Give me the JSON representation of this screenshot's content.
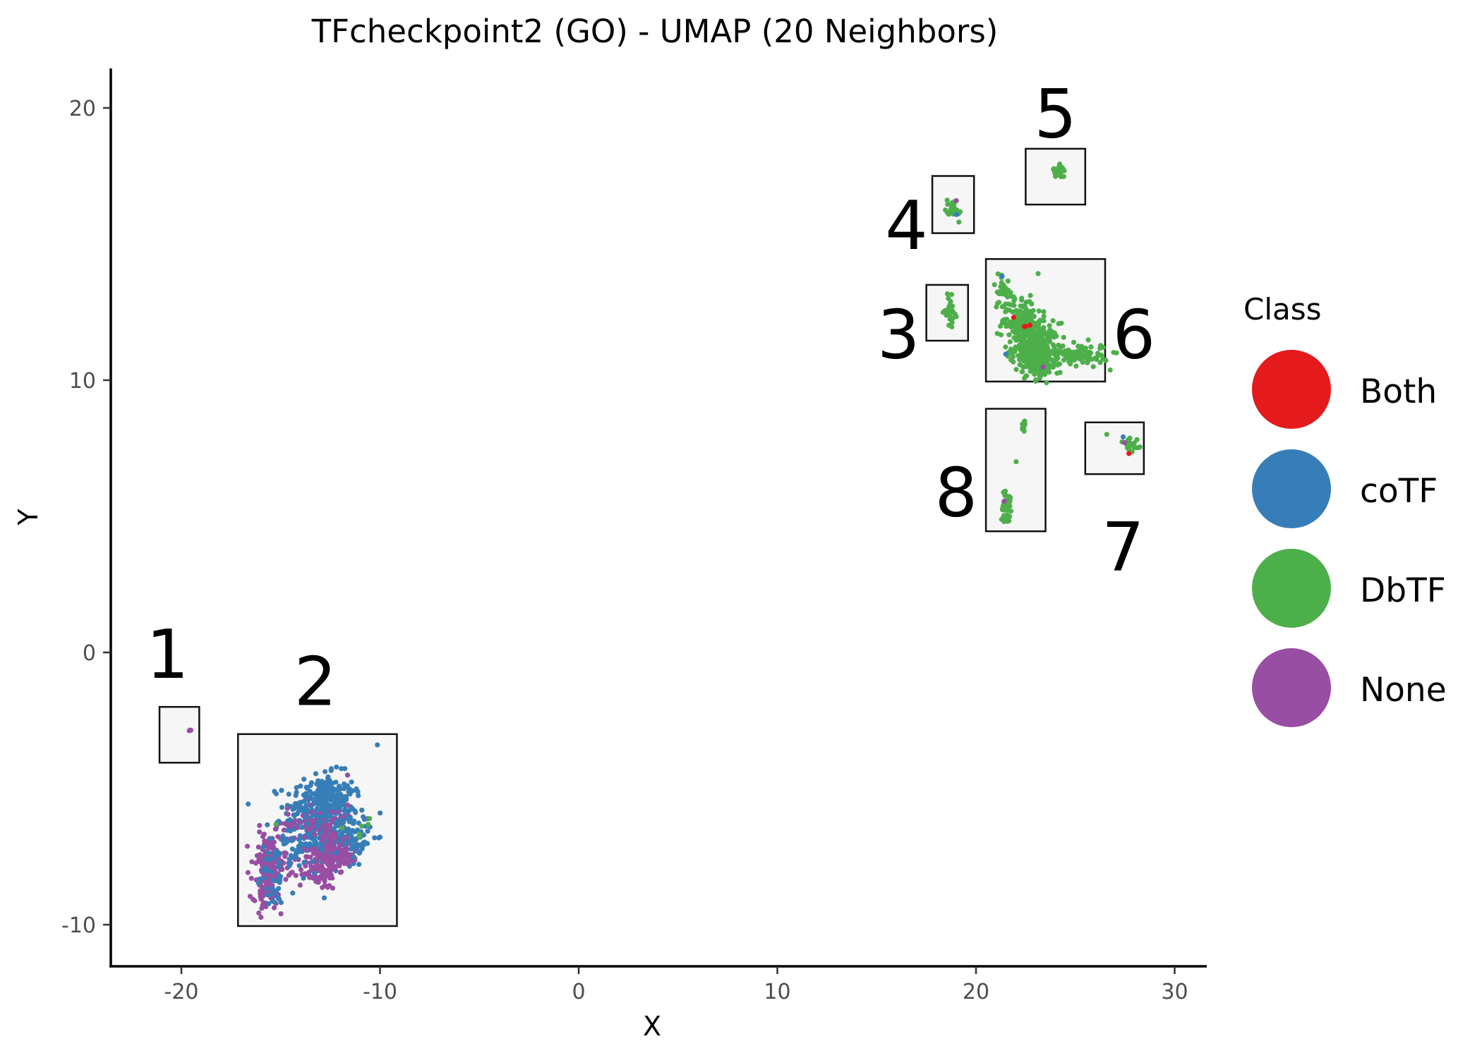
{
  "chart_data": {
    "type": "scatter",
    "title": "TFcheckpoint2 (GO) - UMAP (20 Neighbors)",
    "xlabel": "X",
    "ylabel": "Y",
    "xlim": [
      -23.5,
      31.5
    ],
    "ylim": [
      -11.3,
      21.5
    ],
    "x_ticks": [
      -20,
      -10,
      0,
      10,
      20,
      30
    ],
    "x_tick_labels": [
      "-20",
      "-10",
      "0",
      "10",
      "20",
      "30"
    ],
    "y_ticks": [
      -10,
      0,
      10,
      20
    ],
    "y_tick_labels": [
      "-10",
      "0",
      "10",
      "20"
    ],
    "grid": false,
    "legend": {
      "title": "Class",
      "placement": "right",
      "entries": [
        {
          "name": "Both",
          "color": "#E41A1C"
        },
        {
          "name": "coTF",
          "color": "#377EB8"
        },
        {
          "name": "DbTF",
          "color": "#4DAF4A"
        },
        {
          "name": "None",
          "color": "#984EA3"
        }
      ]
    },
    "cluster_boxes": [
      {
        "label": "1",
        "xmin": -21.1,
        "xmax": -19.1,
        "ymin": -4.05,
        "ymax": -2.0,
        "label_x": -20.7,
        "label_y": -0.05
      },
      {
        "label": "2",
        "xmin": -17.15,
        "xmax": -9.15,
        "ymin": -10.05,
        "ymax": -3.0,
        "label_x": -13.25,
        "label_y": -1.05
      },
      {
        "label": "3",
        "xmin": 17.5,
        "xmax": 19.6,
        "ymin": 11.45,
        "ymax": 13.5,
        "label_x": 16.1,
        "label_y": 11.7
      },
      {
        "label": "4",
        "xmin": 17.8,
        "xmax": 19.9,
        "ymin": 15.4,
        "ymax": 17.5,
        "label_x": 16.5,
        "label_y": 15.7
      },
      {
        "label": "5",
        "xmin": 22.5,
        "xmax": 25.5,
        "ymin": 16.45,
        "ymax": 18.5,
        "label_x": 24.0,
        "label_y": 19.8
      },
      {
        "label": "6",
        "xmin": 20.5,
        "xmax": 26.5,
        "ymin": 9.95,
        "ymax": 14.45,
        "label_x": 27.95,
        "label_y": 11.7
      },
      {
        "label": "7",
        "xmin": 25.5,
        "xmax": 28.45,
        "ymin": 6.55,
        "ymax": 8.45,
        "label_x": 27.4,
        "label_y": 3.9
      },
      {
        "label": "8",
        "xmin": 20.5,
        "xmax": 23.5,
        "ymin": 4.45,
        "ymax": 8.95,
        "label_x": 19.0,
        "label_y": 5.9
      }
    ],
    "point_groups": [
      {
        "cluster": "1",
        "class": "None",
        "x": -19.5,
        "y": -2.9,
        "sx": 0.05,
        "sy": 0.05,
        "n": 3
      },
      {
        "cluster": "2",
        "class": "coTF",
        "x": -13.0,
        "y": -5.9,
        "sx": 0.9,
        "sy": 0.7,
        "n": 260
      },
      {
        "cluster": "2",
        "class": "coTF",
        "x": -12.4,
        "y": -6.7,
        "sx": 0.8,
        "sy": 0.6,
        "n": 140
      },
      {
        "cluster": "2",
        "class": "coTF",
        "x": -14.5,
        "y": -7.3,
        "sx": 0.8,
        "sy": 0.7,
        "n": 60
      },
      {
        "cluster": "2",
        "class": "coTF",
        "x": -15.5,
        "y": -8.6,
        "sx": 0.3,
        "sy": 0.4,
        "n": 25
      },
      {
        "cluster": "2",
        "class": "None",
        "x": -15.6,
        "y": -7.8,
        "sx": 0.45,
        "sy": 0.6,
        "n": 140
      },
      {
        "cluster": "2",
        "class": "None",
        "x": -15.7,
        "y": -8.8,
        "sx": 0.25,
        "sy": 0.35,
        "n": 40
      },
      {
        "cluster": "2",
        "class": "None",
        "x": -13.1,
        "y": -8.0,
        "sx": 0.5,
        "sy": 0.35,
        "n": 110
      },
      {
        "cluster": "2",
        "class": "None",
        "x": -12.0,
        "y": -7.3,
        "sx": 0.45,
        "sy": 0.3,
        "n": 110
      },
      {
        "cluster": "2",
        "class": "None",
        "x": -13.2,
        "y": -6.3,
        "sx": 0.8,
        "sy": 0.45,
        "n": 90
      },
      {
        "cluster": "2",
        "class": "coTF",
        "x": -12.6,
        "y": -5.3,
        "sx": 0.6,
        "sy": 0.4,
        "n": 90
      },
      {
        "cluster": "2",
        "class": "coTF",
        "x": -11.3,
        "y": -6.8,
        "sx": 0.4,
        "sy": 0.4,
        "n": 40
      },
      {
        "cluster": "2",
        "class": "coTF",
        "x": -10.1,
        "y": -3.4,
        "sx": 0.02,
        "sy": 0.02,
        "n": 1
      },
      {
        "cluster": "2",
        "class": "coTF",
        "x": -11.2,
        "y": -5.1,
        "sx": 0.08,
        "sy": 0.06,
        "n": 4
      },
      {
        "cluster": "2",
        "class": "None",
        "x": -11.6,
        "y": -4.5,
        "sx": 0.02,
        "sy": 0.02,
        "n": 1
      },
      {
        "cluster": "2",
        "class": "DbTF",
        "x": -15.2,
        "y": -6.3,
        "sx": 0.02,
        "sy": 0.02,
        "n": 1
      },
      {
        "cluster": "2",
        "class": "DbTF",
        "x": -11.6,
        "y": -6.5,
        "sx": 0.6,
        "sy": 0.5,
        "n": 6
      },
      {
        "cluster": "3",
        "class": "DbTF",
        "x": 18.7,
        "y": 12.55,
        "sx": 0.12,
        "sy": 0.25,
        "n": 30
      },
      {
        "cluster": "4",
        "class": "DbTF",
        "x": 18.85,
        "y": 16.3,
        "sx": 0.2,
        "sy": 0.2,
        "n": 28
      },
      {
        "cluster": "4",
        "class": "None",
        "x": 19.0,
        "y": 16.6,
        "sx": 0.02,
        "sy": 0.02,
        "n": 1
      },
      {
        "cluster": "4",
        "class": "coTF",
        "x": 19.05,
        "y": 16.1,
        "sx": 0.02,
        "sy": 0.02,
        "n": 1
      },
      {
        "cluster": "5",
        "class": "DbTF",
        "x": 24.2,
        "y": 17.65,
        "sx": 0.15,
        "sy": 0.1,
        "n": 25
      },
      {
        "cluster": "6",
        "class": "DbTF",
        "x": 21.3,
        "y": 13.4,
        "sx": 0.2,
        "sy": 0.3,
        "n": 25
      },
      {
        "cluster": "6",
        "class": "DbTF",
        "x": 22.3,
        "y": 12.2,
        "sx": 0.5,
        "sy": 0.5,
        "n": 140
      },
      {
        "cluster": "6",
        "class": "DbTF",
        "x": 23.0,
        "y": 11.2,
        "sx": 0.6,
        "sy": 0.45,
        "n": 260
      },
      {
        "cluster": "6",
        "class": "DbTF",
        "x": 23.2,
        "y": 10.6,
        "sx": 0.45,
        "sy": 0.25,
        "n": 90
      },
      {
        "cluster": "6",
        "class": "DbTF",
        "x": 25.2,
        "y": 10.95,
        "sx": 0.75,
        "sy": 0.2,
        "n": 90
      },
      {
        "cluster": "6",
        "class": "Both",
        "x": 22.6,
        "y": 12.0,
        "sx": 0.15,
        "sy": 0.05,
        "n": 3
      },
      {
        "cluster": "6",
        "class": "Both",
        "x": 21.9,
        "y": 12.3,
        "sx": 0.02,
        "sy": 0.02,
        "n": 1
      },
      {
        "cluster": "6",
        "class": "coTF",
        "x": 21.5,
        "y": 11.0,
        "sx": 0.02,
        "sy": 0.02,
        "n": 1
      },
      {
        "cluster": "6",
        "class": "coTF",
        "x": 21.3,
        "y": 13.8,
        "sx": 0.02,
        "sy": 0.02,
        "n": 1
      },
      {
        "cluster": "6",
        "class": "None",
        "x": 23.4,
        "y": 10.5,
        "sx": 0.02,
        "sy": 0.02,
        "n": 1
      },
      {
        "cluster": "7",
        "class": "DbTF",
        "x": 27.85,
        "y": 7.6,
        "sx": 0.25,
        "sy": 0.2,
        "n": 20
      },
      {
        "cluster": "7",
        "class": "DbTF",
        "x": 26.6,
        "y": 8.0,
        "sx": 0.02,
        "sy": 0.02,
        "n": 1
      },
      {
        "cluster": "7",
        "class": "coTF",
        "x": 27.4,
        "y": 7.9,
        "sx": 0.02,
        "sy": 0.02,
        "n": 1
      },
      {
        "cluster": "7",
        "class": "None",
        "x": 27.5,
        "y": 7.7,
        "sx": 0.02,
        "sy": 0.02,
        "n": 1
      },
      {
        "cluster": "7",
        "class": "Both",
        "x": 27.65,
        "y": 7.3,
        "sx": 0.02,
        "sy": 0.02,
        "n": 1
      },
      {
        "cluster": "8",
        "class": "DbTF",
        "x": 22.4,
        "y": 8.3,
        "sx": 0.05,
        "sy": 0.15,
        "n": 12
      },
      {
        "cluster": "8",
        "class": "DbTF",
        "x": 22.0,
        "y": 7.0,
        "sx": 0.02,
        "sy": 0.02,
        "n": 1
      },
      {
        "cluster": "8",
        "class": "DbTF",
        "x": 21.5,
        "y": 5.4,
        "sx": 0.12,
        "sy": 0.3,
        "n": 40
      },
      {
        "cluster": "8",
        "class": "None",
        "x": 21.4,
        "y": 5.55,
        "sx": 0.02,
        "sy": 0.02,
        "n": 1
      }
    ]
  }
}
